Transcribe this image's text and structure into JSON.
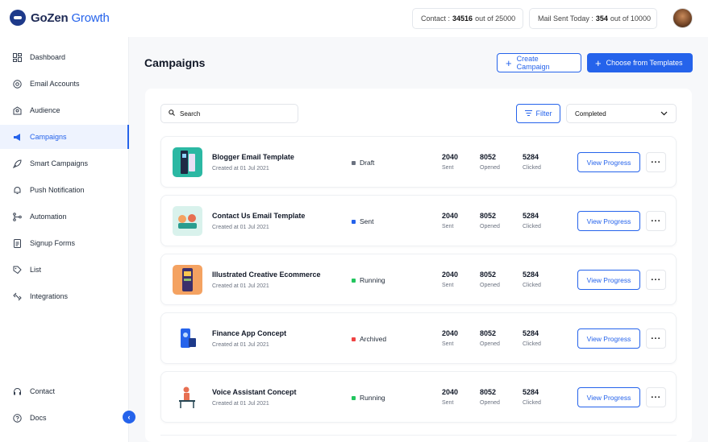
{
  "brand": {
    "name_main": "GoZen",
    "name_accent": "Growth"
  },
  "header": {
    "contact": {
      "label": "Contact :",
      "value": "34516",
      "suffix": "out of 25000"
    },
    "mail": {
      "label": "Mail Sent Today :",
      "value": "354",
      "suffix": "out of 10000"
    }
  },
  "sidebar": {
    "items": [
      {
        "label": "Dashboard",
        "icon": "dashboard-icon"
      },
      {
        "label": "Email Accounts",
        "icon": "at-icon"
      },
      {
        "label": "Audience",
        "icon": "audience-icon"
      },
      {
        "label": "Campaigns",
        "icon": "megaphone-icon",
        "active": true
      },
      {
        "label": "Smart Campaigns",
        "icon": "rocket-icon"
      },
      {
        "label": "Push Notification",
        "icon": "bell-icon"
      },
      {
        "label": "Automation",
        "icon": "automation-icon"
      },
      {
        "label": "Signup Forms",
        "icon": "form-icon"
      },
      {
        "label": "List",
        "icon": "tag-icon"
      },
      {
        "label": "Integrations",
        "icon": "plug-icon"
      }
    ],
    "bottom": [
      {
        "label": "Contact",
        "icon": "headset-icon"
      },
      {
        "label": "Docs",
        "icon": "help-icon"
      }
    ]
  },
  "main": {
    "title": "Campaigns",
    "create_label": "Create Campaign",
    "templates_label": "Choose from Templates",
    "search_placeholder": "Search",
    "filter_label": "Filter",
    "select_value": "Completed"
  },
  "campaigns": [
    {
      "title": "Blogger Email Template",
      "date": "Created at 01 Jul 2021",
      "status": "Draft",
      "status_color": "#6b7280",
      "sent": "2040",
      "opened": "8052",
      "clicked": "5284",
      "thumb": "teal"
    },
    {
      "title": "Contact Us Email Template",
      "date": "Created at 01 Jul 2021",
      "status": "Sent",
      "status_color": "#2563eb",
      "sent": "2040",
      "opened": "8052",
      "clicked": "5284",
      "thumb": "mint"
    },
    {
      "title": "Illustrated Creative Ecommerce",
      "date": "Created at 01 Jul 2021",
      "status": "Running",
      "status_color": "#22c55e",
      "sent": "2040",
      "opened": "8052",
      "clicked": "5284",
      "thumb": "orange"
    },
    {
      "title": "Finance App Concept",
      "date": "Created at 01 Jul 2021",
      "status": "Archived",
      "status_color": "#ef4444",
      "sent": "2040",
      "opened": "8052",
      "clicked": "5284",
      "thumb": "blue"
    },
    {
      "title": "Voice Assistant Concept",
      "date": "Created at 01 Jul 2021",
      "status": "Running",
      "status_color": "#22c55e",
      "sent": "2040",
      "opened": "8052",
      "clicked": "5284",
      "thumb": "white"
    }
  ],
  "labels": {
    "sent": "Sent",
    "opened": "Opened",
    "clicked": "Clicked",
    "view_progress": "View Progress"
  }
}
